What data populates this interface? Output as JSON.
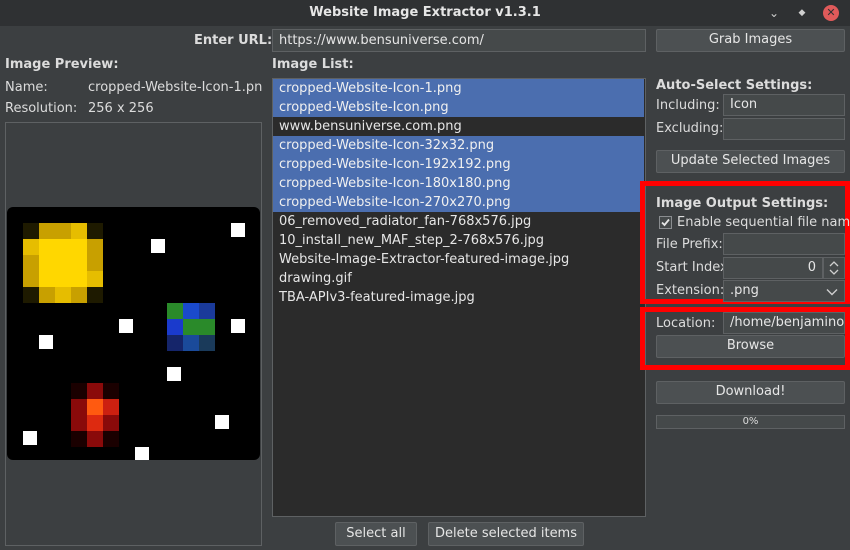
{
  "window": {
    "title": "Website Image Extractor v1.3.1"
  },
  "url": {
    "label": "Enter URL:",
    "value": "https://www.bensuniverse.com/",
    "grab_button": "Grab Images"
  },
  "preview": {
    "header": "Image Preview:",
    "name_label": "Name:",
    "name_value": "cropped-Website-Icon-1.pn...",
    "resolution_label": "Resolution:",
    "resolution_value": "256 x 256"
  },
  "image_list": {
    "header": "Image List:",
    "items": [
      {
        "label": "cropped-Website-Icon-1.png",
        "selected": true
      },
      {
        "label": "cropped-Website-Icon.png",
        "selected": true
      },
      {
        "label": "www.bensuniverse.com.png",
        "selected": false
      },
      {
        "label": "cropped-Website-Icon-32x32.png",
        "selected": true
      },
      {
        "label": "cropped-Website-Icon-192x192.png",
        "selected": true
      },
      {
        "label": "cropped-Website-Icon-180x180.png",
        "selected": true
      },
      {
        "label": "cropped-Website-Icon-270x270.png",
        "selected": true
      },
      {
        "label": "06_removed_radiator_fan-768x576.jpg",
        "selected": false
      },
      {
        "label": "10_install_new_MAF_step_2-768x576.jpg",
        "selected": false
      },
      {
        "label": "Website-Image-Extractor-featured-image.jpg",
        "selected": false
      },
      {
        "label": "drawing.gif",
        "selected": false
      },
      {
        "label": "TBA-APIv3-featured-image.jpg",
        "selected": false
      }
    ],
    "select_all_button": "Select all",
    "delete_button": "Delete selected items"
  },
  "auto_select": {
    "header": "Auto-Select Settings:",
    "including_label": "Including:",
    "including_value": "Icon",
    "excluding_label": "Excluding:",
    "excluding_value": "",
    "update_button": "Update Selected Images"
  },
  "output": {
    "header": "Image Output Settings:",
    "sequential_label": "Enable sequential file names",
    "sequential_checked": true,
    "prefix_label": "File Prefix:",
    "prefix_value": "",
    "start_index_label": "Start Index:",
    "start_index_value": "0",
    "extension_label": "Extension:",
    "extension_value": ".png",
    "location_label": "Location:",
    "location_value": "/home/benjaminow",
    "browse_button": "Browse"
  },
  "download": {
    "button": "Download!",
    "progress_text": "0%",
    "progress_fraction": 0
  },
  "colors": {
    "selection": "#4b6eaf",
    "highlight": "#ff0000",
    "background": "#3c3f41"
  }
}
